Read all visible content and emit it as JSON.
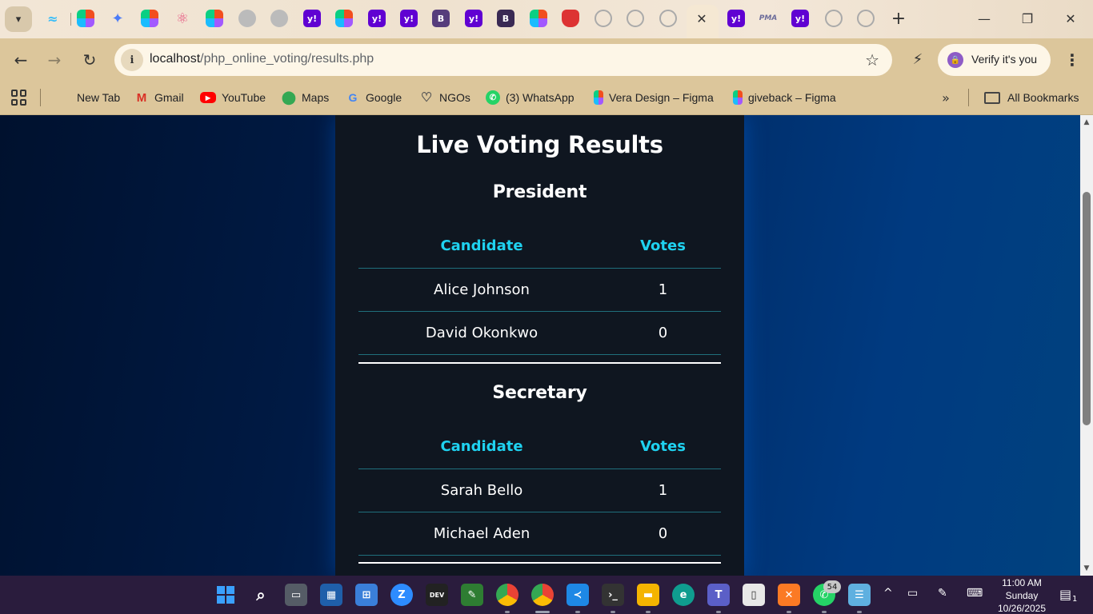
{
  "browser": {
    "tabs": {
      "menu_icon": "chevron-down-icon",
      "favicons": [
        "tailwind-icon",
        "figma-icon",
        "gemini-icon",
        "figma-icon",
        "react-icon",
        "figma-icon",
        "globe-icon",
        "globe-icon",
        "yahoo-icon",
        "figma-icon",
        "yahoo-icon",
        "yahoo-icon",
        "bootstrap-icon",
        "yahoo-icon",
        "bootstrap-icon",
        "figma-icon",
        "brave-shield-icon",
        "github-icon",
        "github-icon",
        "github-icon"
      ],
      "after_active": [
        "yahoo-icon",
        "phpmyadmin-icon",
        "yahoo-icon",
        "github-icon",
        "github-icon"
      ],
      "yahoo_glyph": "y!",
      "bootstrap_glyph": "B",
      "pma_glyph": "PMA",
      "close_glyph": "✕",
      "new_tab_glyph": "+"
    },
    "window_controls": {
      "minimize": "—",
      "restore": "❐",
      "close": "✕"
    },
    "toolbar": {
      "back": "←",
      "forward": "→",
      "reload": "↻",
      "info_glyph": "i",
      "url_host": "localhost",
      "url_path": "/php_online_voting/results.php",
      "bookmark_star": "☆",
      "extension_glyph": "⚡",
      "verify_label": "Verify it's you",
      "menu_glyph": "⋮"
    },
    "bookmarks": {
      "items": [
        {
          "label": "New Tab",
          "icon": "none"
        },
        {
          "label": "Gmail",
          "icon": "gmail-icon"
        },
        {
          "label": "YouTube",
          "icon": "youtube-icon"
        },
        {
          "label": "Maps",
          "icon": "maps-icon"
        },
        {
          "label": "Google",
          "icon": "google-icon"
        },
        {
          "label": "NGOs",
          "icon": "heart-hands-icon"
        },
        {
          "label": "(3) WhatsApp",
          "icon": "whatsapp-icon"
        },
        {
          "label": "Vera Design – Figma",
          "icon": "figma-icon"
        },
        {
          "label": "giveback – Figma",
          "icon": "figma-icon"
        }
      ],
      "more_glyph": "»",
      "all_bookmarks": "All Bookmarks"
    }
  },
  "page": {
    "title": "Live Voting Results",
    "sections": [
      {
        "title": "President",
        "headers": {
          "candidate": "Candidate",
          "votes": "Votes"
        },
        "rows": [
          {
            "candidate": "Alice Johnson",
            "votes": "1"
          },
          {
            "candidate": "David Okonkwo",
            "votes": "0"
          }
        ]
      },
      {
        "title": "Secretary",
        "headers": {
          "candidate": "Candidate",
          "votes": "Votes"
        },
        "rows": [
          {
            "candidate": "Sarah Bello",
            "votes": "1"
          },
          {
            "candidate": "Michael Aden",
            "votes": "0"
          }
        ]
      }
    ],
    "colors": {
      "header_accent": "#1fd2f0",
      "card_bg": "#0f1620"
    }
  },
  "scrollbar": {
    "up": "▲",
    "down": "▼"
  },
  "taskbar": {
    "whatsapp_badge": "54",
    "clock": {
      "time": "11:00 AM",
      "day": "Sunday",
      "date": "10/26/2025"
    },
    "notification_count": "1",
    "tray_chevron": "^",
    "zoom_glyph": "Z",
    "dev_glyph": "DEV"
  }
}
